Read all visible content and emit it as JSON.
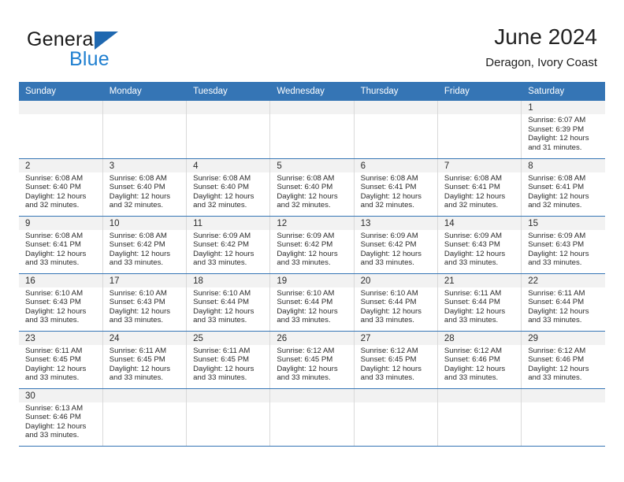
{
  "brand": {
    "name_top": "General",
    "name_bottom": "Blue",
    "logo_color": "#1f68b0",
    "text_color": "#1f7fd0"
  },
  "header": {
    "title": "June 2024",
    "subtitle": "Deragon, Ivory Coast"
  },
  "theme": {
    "header_bg": "#3575b5",
    "daynum_bg": "#f2f2f2",
    "row_border": "#3575b5",
    "cell_border": "#d9d9d9"
  },
  "weekdays": [
    "Sunday",
    "Monday",
    "Tuesday",
    "Wednesday",
    "Thursday",
    "Friday",
    "Saturday"
  ],
  "labels": {
    "sunrise": "Sunrise:",
    "sunset": "Sunset:",
    "daylight": "Daylight:"
  },
  "weeks": [
    [
      {
        "day": "",
        "blank": true
      },
      {
        "day": "",
        "blank": true
      },
      {
        "day": "",
        "blank": true
      },
      {
        "day": "",
        "blank": true
      },
      {
        "day": "",
        "blank": true
      },
      {
        "day": "",
        "blank": true
      },
      {
        "day": "1",
        "sunrise": "Sunrise: 6:07 AM",
        "sunset": "Sunset: 6:39 PM",
        "daylight": "Daylight: 12 hours and 31 minutes."
      }
    ],
    [
      {
        "day": "2",
        "sunrise": "Sunrise: 6:08 AM",
        "sunset": "Sunset: 6:40 PM",
        "daylight": "Daylight: 12 hours and 32 minutes."
      },
      {
        "day": "3",
        "sunrise": "Sunrise: 6:08 AM",
        "sunset": "Sunset: 6:40 PM",
        "daylight": "Daylight: 12 hours and 32 minutes."
      },
      {
        "day": "4",
        "sunrise": "Sunrise: 6:08 AM",
        "sunset": "Sunset: 6:40 PM",
        "daylight": "Daylight: 12 hours and 32 minutes."
      },
      {
        "day": "5",
        "sunrise": "Sunrise: 6:08 AM",
        "sunset": "Sunset: 6:40 PM",
        "daylight": "Daylight: 12 hours and 32 minutes."
      },
      {
        "day": "6",
        "sunrise": "Sunrise: 6:08 AM",
        "sunset": "Sunset: 6:41 PM",
        "daylight": "Daylight: 12 hours and 32 minutes."
      },
      {
        "day": "7",
        "sunrise": "Sunrise: 6:08 AM",
        "sunset": "Sunset: 6:41 PM",
        "daylight": "Daylight: 12 hours and 32 minutes."
      },
      {
        "day": "8",
        "sunrise": "Sunrise: 6:08 AM",
        "sunset": "Sunset: 6:41 PM",
        "daylight": "Daylight: 12 hours and 32 minutes."
      }
    ],
    [
      {
        "day": "9",
        "sunrise": "Sunrise: 6:08 AM",
        "sunset": "Sunset: 6:41 PM",
        "daylight": "Daylight: 12 hours and 33 minutes."
      },
      {
        "day": "10",
        "sunrise": "Sunrise: 6:08 AM",
        "sunset": "Sunset: 6:42 PM",
        "daylight": "Daylight: 12 hours and 33 minutes."
      },
      {
        "day": "11",
        "sunrise": "Sunrise: 6:09 AM",
        "sunset": "Sunset: 6:42 PM",
        "daylight": "Daylight: 12 hours and 33 minutes."
      },
      {
        "day": "12",
        "sunrise": "Sunrise: 6:09 AM",
        "sunset": "Sunset: 6:42 PM",
        "daylight": "Daylight: 12 hours and 33 minutes."
      },
      {
        "day": "13",
        "sunrise": "Sunrise: 6:09 AM",
        "sunset": "Sunset: 6:42 PM",
        "daylight": "Daylight: 12 hours and 33 minutes."
      },
      {
        "day": "14",
        "sunrise": "Sunrise: 6:09 AM",
        "sunset": "Sunset: 6:43 PM",
        "daylight": "Daylight: 12 hours and 33 minutes."
      },
      {
        "day": "15",
        "sunrise": "Sunrise: 6:09 AM",
        "sunset": "Sunset: 6:43 PM",
        "daylight": "Daylight: 12 hours and 33 minutes."
      }
    ],
    [
      {
        "day": "16",
        "sunrise": "Sunrise: 6:10 AM",
        "sunset": "Sunset: 6:43 PM",
        "daylight": "Daylight: 12 hours and 33 minutes."
      },
      {
        "day": "17",
        "sunrise": "Sunrise: 6:10 AM",
        "sunset": "Sunset: 6:43 PM",
        "daylight": "Daylight: 12 hours and 33 minutes."
      },
      {
        "day": "18",
        "sunrise": "Sunrise: 6:10 AM",
        "sunset": "Sunset: 6:44 PM",
        "daylight": "Daylight: 12 hours and 33 minutes."
      },
      {
        "day": "19",
        "sunrise": "Sunrise: 6:10 AM",
        "sunset": "Sunset: 6:44 PM",
        "daylight": "Daylight: 12 hours and 33 minutes."
      },
      {
        "day": "20",
        "sunrise": "Sunrise: 6:10 AM",
        "sunset": "Sunset: 6:44 PM",
        "daylight": "Daylight: 12 hours and 33 minutes."
      },
      {
        "day": "21",
        "sunrise": "Sunrise: 6:11 AM",
        "sunset": "Sunset: 6:44 PM",
        "daylight": "Daylight: 12 hours and 33 minutes."
      },
      {
        "day": "22",
        "sunrise": "Sunrise: 6:11 AM",
        "sunset": "Sunset: 6:44 PM",
        "daylight": "Daylight: 12 hours and 33 minutes."
      }
    ],
    [
      {
        "day": "23",
        "sunrise": "Sunrise: 6:11 AM",
        "sunset": "Sunset: 6:45 PM",
        "daylight": "Daylight: 12 hours and 33 minutes."
      },
      {
        "day": "24",
        "sunrise": "Sunrise: 6:11 AM",
        "sunset": "Sunset: 6:45 PM",
        "daylight": "Daylight: 12 hours and 33 minutes."
      },
      {
        "day": "25",
        "sunrise": "Sunrise: 6:11 AM",
        "sunset": "Sunset: 6:45 PM",
        "daylight": "Daylight: 12 hours and 33 minutes."
      },
      {
        "day": "26",
        "sunrise": "Sunrise: 6:12 AM",
        "sunset": "Sunset: 6:45 PM",
        "daylight": "Daylight: 12 hours and 33 minutes."
      },
      {
        "day": "27",
        "sunrise": "Sunrise: 6:12 AM",
        "sunset": "Sunset: 6:45 PM",
        "daylight": "Daylight: 12 hours and 33 minutes."
      },
      {
        "day": "28",
        "sunrise": "Sunrise: 6:12 AM",
        "sunset": "Sunset: 6:46 PM",
        "daylight": "Daylight: 12 hours and 33 minutes."
      },
      {
        "day": "29",
        "sunrise": "Sunrise: 6:12 AM",
        "sunset": "Sunset: 6:46 PM",
        "daylight": "Daylight: 12 hours and 33 minutes."
      }
    ],
    [
      {
        "day": "30",
        "sunrise": "Sunrise: 6:13 AM",
        "sunset": "Sunset: 6:46 PM",
        "daylight": "Daylight: 12 hours and 33 minutes."
      },
      {
        "day": "",
        "blank": true
      },
      {
        "day": "",
        "blank": true
      },
      {
        "day": "",
        "blank": true
      },
      {
        "day": "",
        "blank": true
      },
      {
        "day": "",
        "blank": true
      },
      {
        "day": "",
        "blank": true
      }
    ]
  ]
}
